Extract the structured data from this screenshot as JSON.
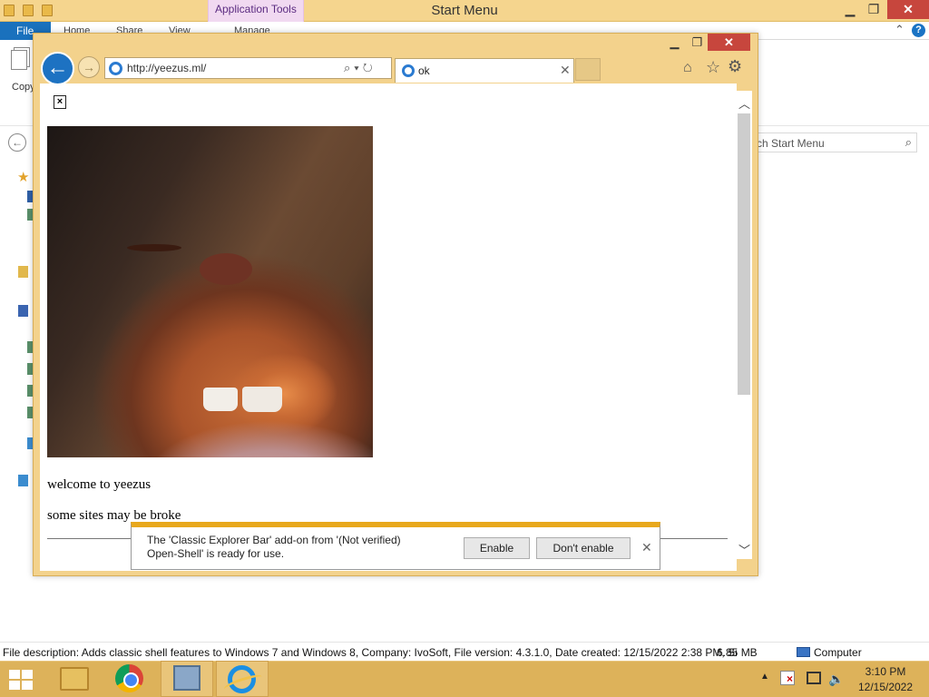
{
  "explorer": {
    "title": "Start Menu",
    "context_tab": "Application Tools",
    "ribbon": {
      "file": "File",
      "tabs": [
        "Home",
        "Share",
        "View",
        "Manage"
      ]
    },
    "copy_label": "Copy",
    "search_placeholder": "rch Start Menu"
  },
  "status_bar": {
    "description": "File description: Adds classic shell features to Windows 7 and Windows 8, Company: IvoSoft, File version: 4.3.1.0, Date created: 12/15/2022 2:38 PM, Si",
    "size": "6.85 MB",
    "location": "Computer"
  },
  "browser": {
    "url": "http://yeezus.ml/",
    "tab_title": "ok",
    "page": {
      "welcome_text": "welcome to yeezus",
      "broke_text": "some sites may be broke"
    },
    "notification": {
      "message": "The 'Classic Explorer Bar' add-on from '(Not verified) Open-Shell' is ready for use.",
      "enable_label": "Enable",
      "dont_enable_label": "Don't enable"
    }
  },
  "taskbar": {
    "clock_time": "3:10 PM",
    "clock_date": "12/15/2022"
  },
  "icons": {
    "browser_back": "back-arrow-icon",
    "browser_forward": "forward-arrow-icon",
    "home": "home-icon",
    "favorites": "star-icon",
    "settings": "gear-icon",
    "search": "search-icon",
    "refresh": "refresh-icon",
    "close": "close-icon"
  },
  "colors": {
    "window_frame": "#f3d28c",
    "taskbar": "#ddb25a",
    "notification_accent": "#e8a81c",
    "close_button": "#c7463d",
    "ribbon_file": "#1a71bd"
  }
}
